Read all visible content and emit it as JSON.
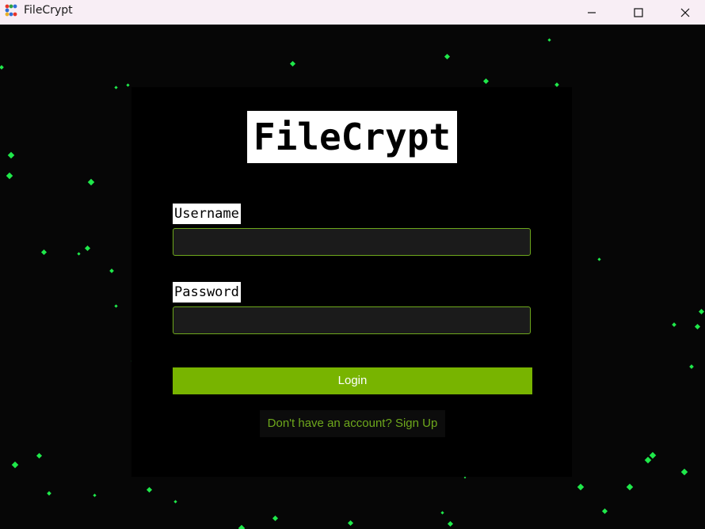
{
  "window": {
    "title": "FileCrypt",
    "app_icon": "app-grid-icon",
    "controls": {
      "minimize_icon": "minimize-icon",
      "maximize_icon": "maximize-icon",
      "close_icon": "close-icon"
    }
  },
  "login": {
    "logo_text": "FileCrypt",
    "username_label": "Username",
    "username_value": "",
    "password_label": "Password",
    "password_value": "",
    "login_button": "Login",
    "signup_link": "Don't have an account? Sign Up"
  },
  "colors": {
    "background": "#060606",
    "card": "#000000",
    "accent": "#78b400",
    "particles": "#1fe84a",
    "input_bg": "#1b1b1b"
  }
}
